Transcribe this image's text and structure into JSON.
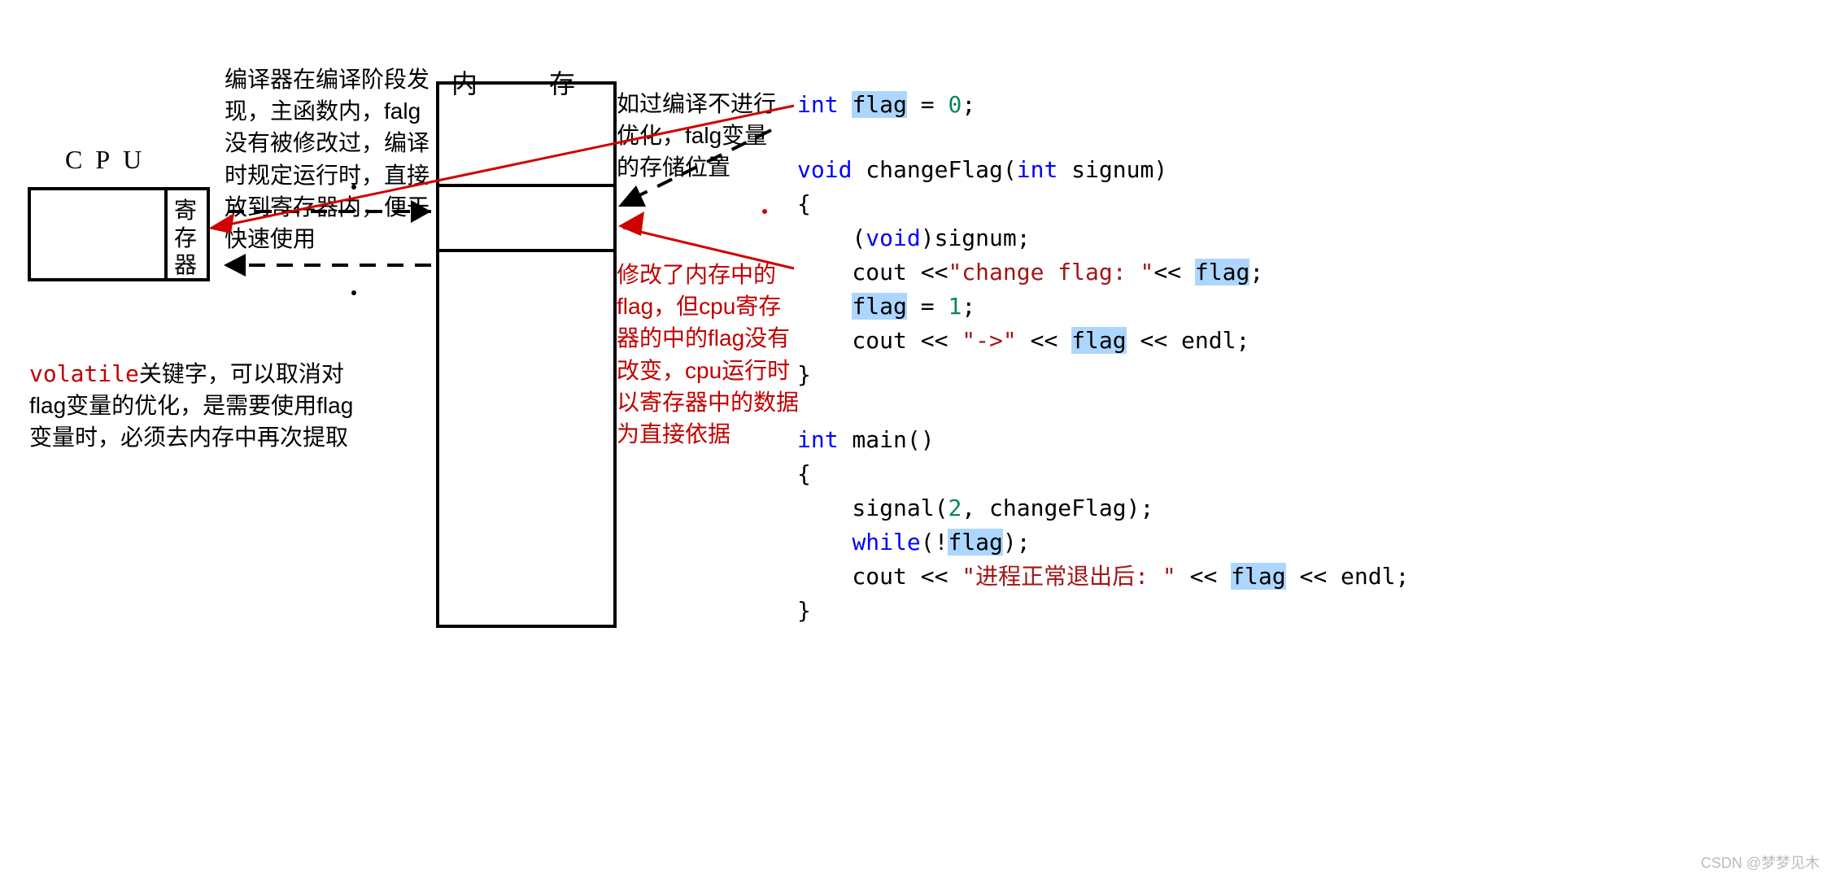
{
  "labels": {
    "cpu": "CPU",
    "memory": "内　存",
    "register_c1": "寄",
    "register_c2": "存",
    "register_c3": "器"
  },
  "annotations": {
    "compiler_note": "编译器在编译阶段发现，主函数内，falg没有被修改过，编译时规定运行时，直接放到寄存器内，便于快速使用",
    "no_opt_note": "如过编译不进行优化，falg变量的存储位置",
    "modify_note": "修改了内存中的flag，但cpu寄存器的中的flag没有改变，cpu运行时以寄存器中的数据为直接依据",
    "volatile_kw": "volatile",
    "volatile_note": "关键字，可以取消对flag变量的优化，是需要使用flag变量时，必须去内存中再次提取"
  },
  "code": {
    "l1_kw": "int",
    "l1_var": "flag",
    "l1_rest": " = ",
    "l1_num": "0",
    "l1_semi": ";",
    "l2_kw": "void",
    "l2_fn": " changeFlag(",
    "l2_kw2": "int",
    "l2_rest": " signum)",
    "l3": "{",
    "l4_a": "    (",
    "l4_kw": "void",
    "l4_b": ")signum;",
    "l5_a": "    cout <<",
    "l5_str": "\"change flag: \"",
    "l5_b": "<< ",
    "l5_var": "flag",
    "l5_c": ";",
    "l6_a": "    ",
    "l6_var": "flag",
    "l6_b": " = ",
    "l6_num": "1",
    "l6_c": ";",
    "l7_a": "    cout << ",
    "l7_str": "\"->\"",
    "l7_b": " << ",
    "l7_var": "flag",
    "l7_c": " << endl;",
    "l8": "}",
    "l10_kw": "int",
    "l10_fn": " main()",
    "l11": "{",
    "l12_a": "    signal(",
    "l12_num": "2",
    "l12_b": ", changeFlag);",
    "l13_a": "    ",
    "l13_kw": "while",
    "l13_b": "(!",
    "l13_var": "flag",
    "l13_c": ");",
    "l14_a": "    cout << ",
    "l14_str": "\"进程正常退出后: \"",
    "l14_b": " << ",
    "l14_var": "flag",
    "l14_c": " << endl;",
    "l15": "}"
  },
  "watermark": "CSDN @梦梦见木"
}
